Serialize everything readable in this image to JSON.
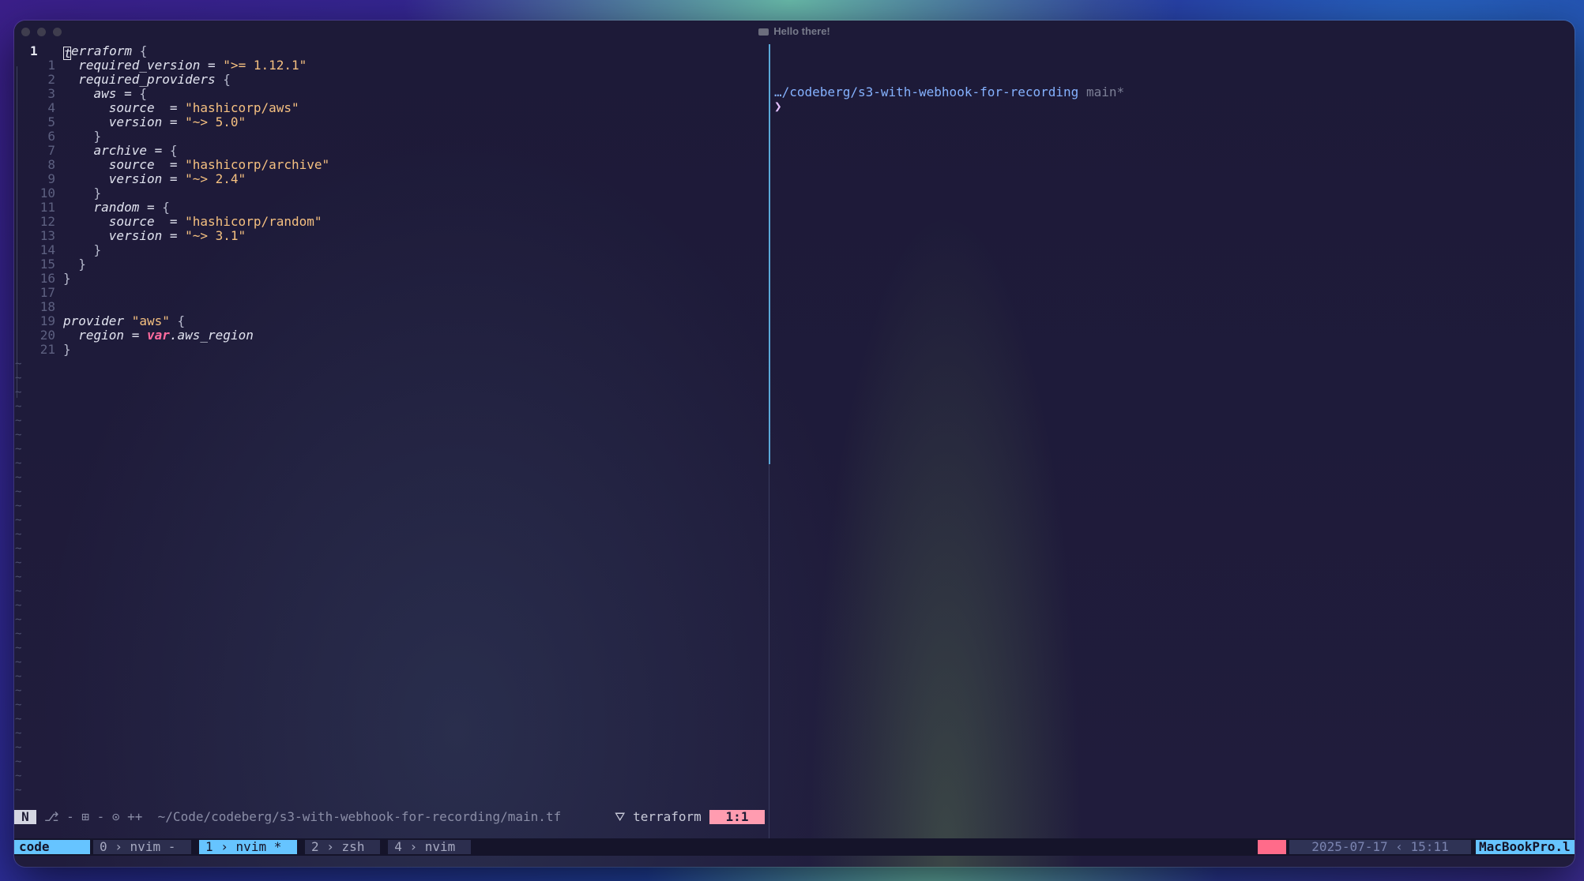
{
  "window": {
    "title": "Hello there!"
  },
  "editor": {
    "current_line_number": "1",
    "lines": [
      {
        "n": "1",
        "code": "terraform {"
      },
      {
        "n": "1",
        "code": "  required_version = \">= 1.12.1\""
      },
      {
        "n": "2",
        "code": "  required_providers {"
      },
      {
        "n": "3",
        "code": "    aws = {"
      },
      {
        "n": "4",
        "code": "      source  = \"hashicorp/aws\""
      },
      {
        "n": "5",
        "code": "      version = \"~> 5.0\""
      },
      {
        "n": "6",
        "code": "    }"
      },
      {
        "n": "7",
        "code": "    archive = {"
      },
      {
        "n": "8",
        "code": "      source  = \"hashicorp/archive\""
      },
      {
        "n": "9",
        "code": "      version = \"~> 2.4\""
      },
      {
        "n": "10",
        "code": "    }"
      },
      {
        "n": "11",
        "code": "    random = {"
      },
      {
        "n": "12",
        "code": "      source  = \"hashicorp/random\""
      },
      {
        "n": "13",
        "code": "      version = \"~> 3.1\""
      },
      {
        "n": "14",
        "code": "    }"
      },
      {
        "n": "15",
        "code": "  }"
      },
      {
        "n": "16",
        "code": "}"
      },
      {
        "n": "17",
        "code": ""
      },
      {
        "n": "18",
        "code": ""
      },
      {
        "n": "19",
        "code": "provider \"aws\" {"
      },
      {
        "n": "20",
        "code": "  region = var.aws_region"
      },
      {
        "n": "21",
        "code": "}"
      }
    ],
    "tilde": "~"
  },
  "statusline": {
    "mode": "N",
    "info": "⎇ - ⊞ - ⊙ ++  ~/Code/codeberg/s3-with-webhook-for-recording/main.tf",
    "filetype": "⛛ terraform",
    "position": "1:1"
  },
  "shell": {
    "path": "…/codeberg/s3-with-webhook-for-recording",
    "branch": "main*",
    "prompt": "❯"
  },
  "tmux": {
    "session": "code",
    "windows": [
      {
        "index": "0",
        "name": "nvim -",
        "active": false
      },
      {
        "index": "1",
        "name": "nvim *",
        "active": true
      },
      {
        "index": "2",
        "name": "zsh",
        "active": false
      },
      {
        "index": "4",
        "name": "nvim",
        "active": false
      }
    ],
    "date": "2025-07-17",
    "time": "15:11",
    "host": "MacBookPro.l"
  }
}
